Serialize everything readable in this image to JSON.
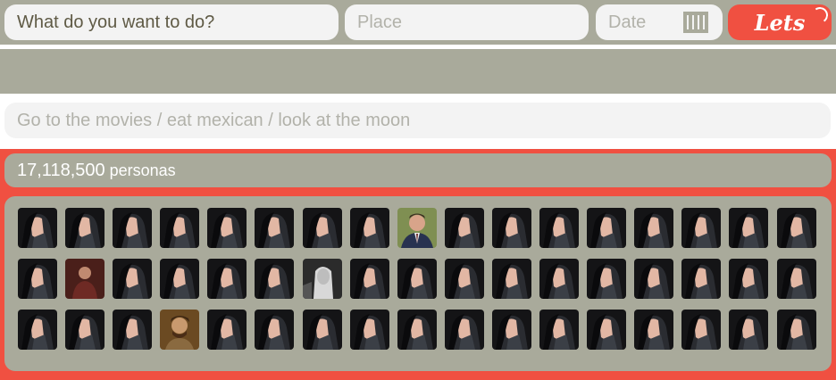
{
  "form": {
    "what_value": "What do you want to do?",
    "place_placeholder": "Place",
    "date_placeholder": "Date",
    "submit_label": "Lets",
    "example_placeholder": "Go to the movies / eat mexican / look at the moon"
  },
  "results": {
    "count": "17,118,500",
    "count_unit": "personas",
    "avatar_rows": [
      [
        "dark-portrait",
        "dark-portrait",
        "dark-portrait",
        "dark-portrait",
        "dark-portrait",
        "dark-portrait",
        "dark-portrait",
        "dark-portrait",
        "suit-portrait",
        "dark-portrait",
        "dark-portrait",
        "dark-portrait",
        "dark-portrait",
        "dark-portrait",
        "dark-portrait",
        "dark-portrait",
        "dark-portrait"
      ],
      [
        "dark-portrait",
        "red-portrait",
        "dark-portrait",
        "dark-portrait",
        "dark-portrait",
        "dark-portrait",
        "bw-portrait",
        "dark-portrait",
        "dark-portrait",
        "dark-portrait",
        "dark-portrait",
        "dark-portrait",
        "dark-portrait",
        "dark-portrait",
        "dark-portrait",
        "dark-portrait",
        "dark-portrait"
      ],
      [
        "dark-portrait",
        "dark-portrait",
        "dark-portrait",
        "warm-portrait",
        "dark-portrait",
        "dark-portrait",
        "dark-portrait",
        "dark-portrait",
        "dark-portrait",
        "dark-portrait",
        "dark-portrait",
        "dark-portrait",
        "dark-portrait",
        "dark-portrait",
        "dark-portrait",
        "dark-portrait",
        "dark-portrait"
      ]
    ]
  },
  "colors": {
    "accent": "#f05041",
    "panel": "#a9aa9b",
    "field": "#f3f3f3",
    "placeholder_text": "#b2b2aa"
  }
}
